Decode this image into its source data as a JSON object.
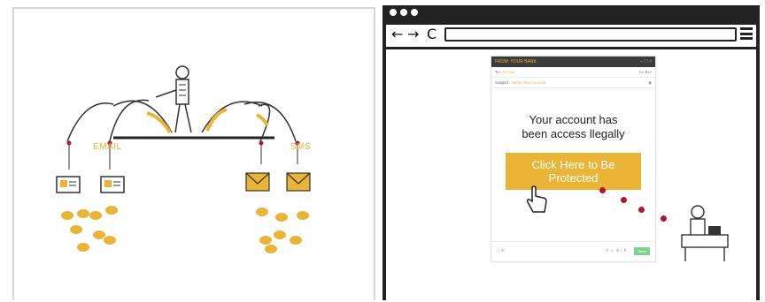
{
  "left_panel": {
    "labels": {
      "email": "EMAIL",
      "sms": "SMS"
    }
  },
  "browser": {
    "nav": {
      "back_icon": "←",
      "forward_icon": "→",
      "reload_icon": "C"
    }
  },
  "email": {
    "header": "FROM: YOUR BANK",
    "header_controls": "– ☐ ×",
    "to_label": "To :",
    "to_value": "To You",
    "cc": "Cc  Bcc",
    "subject_label": "Subject :",
    "subject_value": "Verify Your Account",
    "message_line1": "Your account has",
    "message_line2": "been access llegally",
    "cta_line1": "Click Here to Be",
    "cta_line2": "Protected",
    "footer_left": "‹  |  ⊞",
    "footer_icons": "⚲ ☺ ⊕ | ⬆",
    "send": "Send"
  },
  "colors": {
    "accent": "#eab536",
    "dark": "#222222",
    "red": "#b0182a"
  }
}
